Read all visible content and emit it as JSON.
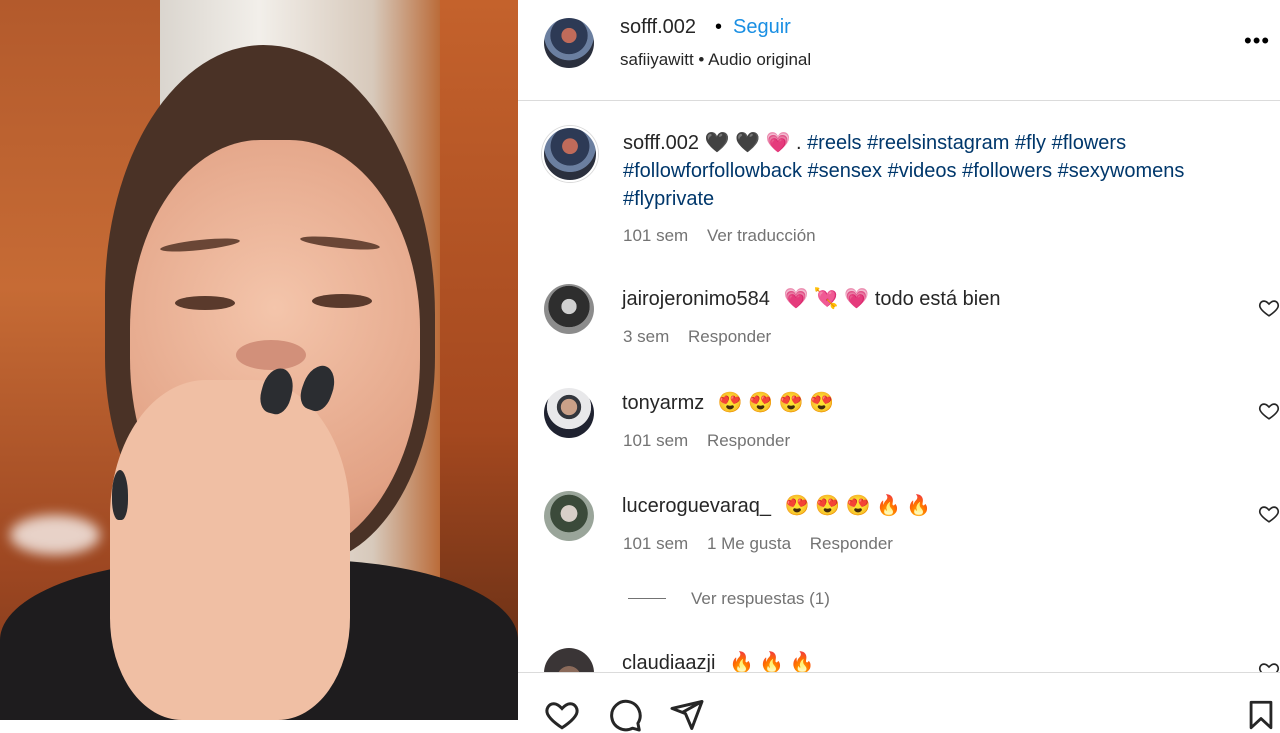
{
  "post": {
    "author": "sofff.002",
    "follow_label": "Seguir",
    "subtitle": "safiiyawitt • Audio original",
    "more_label": "•••"
  },
  "caption": {
    "author": "sofff.002",
    "emojis": "🖤 🖤 💗 .",
    "hashtags": "#reels #reelsinstagram #fly #flowers #followforfollowback #sensex #videos #followers #sexywomens #flyprivate",
    "time": "101 sem",
    "translate_label": "Ver traducción"
  },
  "comments": [
    {
      "user": "jairojeronimo584",
      "text": "💗 💘 💗  todo está bien",
      "time": "3 sem",
      "likes": "",
      "reply_label": "Responder"
    },
    {
      "user": "tonyarmz",
      "text": "😍 😍 😍 😍",
      "time": "101 sem",
      "likes": "",
      "reply_label": "Responder"
    },
    {
      "user": "luceroguevaraq_",
      "text": "😍 😍 😍 🔥 🔥",
      "time": "101 sem",
      "likes": "1 Me gusta",
      "reply_label": "Responder"
    },
    {
      "user": "claudiaazji",
      "text": "🔥 🔥 🔥",
      "time": "",
      "likes": "",
      "reply_label": ""
    }
  ],
  "view_replies_label": "Ver respuestas (1)",
  "icons": {
    "like": "heart-icon",
    "comment": "comment-icon",
    "share": "send-icon",
    "save": "bookmark-icon"
  },
  "colors": {
    "link": "#1a8fe3",
    "hashtag": "#00376b",
    "muted": "#737373"
  }
}
